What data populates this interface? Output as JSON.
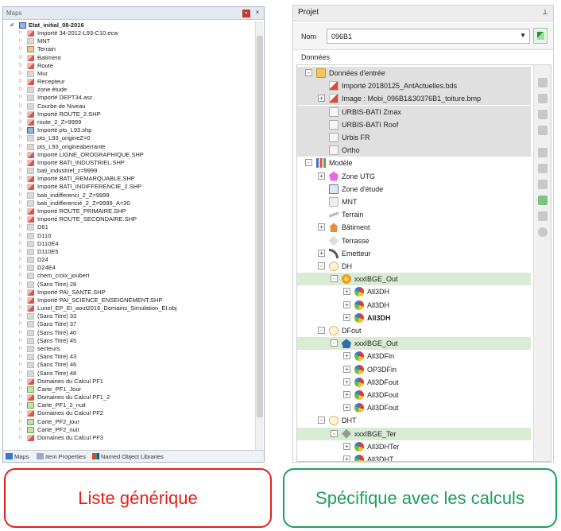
{
  "left": {
    "title": "Maps",
    "root_label": "Etat_initial_08-2016",
    "layers": [
      {
        "label": "Importé 34-2012-L93-C10.ecw",
        "icon": "red"
      },
      {
        "label": "MNT",
        "icon": "grey"
      },
      {
        "label": "Terrain",
        "icon": "tan"
      },
      {
        "label": "Batiment",
        "icon": "red"
      },
      {
        "label": "Route",
        "icon": "red"
      },
      {
        "label": "Mur",
        "icon": "grey"
      },
      {
        "label": "Recepteur",
        "icon": "red"
      },
      {
        "label": "zone étude",
        "icon": "grey"
      },
      {
        "label": "Importé DEPT34.asc",
        "icon": "grey"
      },
      {
        "label": "Courbe de Niveau",
        "icon": "grey"
      },
      {
        "label": "Importé ROUTE_2.SHP",
        "icon": "red"
      },
      {
        "label": "route_2_Z=9999",
        "icon": "red"
      },
      {
        "label": "Importé pts_L93.shp",
        "icon": "blue"
      },
      {
        "label": "pts_L93_origineZ=0",
        "icon": "grey"
      },
      {
        "label": "pts_L93_origineaberrante",
        "icon": "grey"
      },
      {
        "label": "Importé LIGNE_OROGRAPHIQUE.SHP",
        "icon": "red"
      },
      {
        "label": "Importé BATI_INDUSTRIEL.SHP",
        "icon": "red"
      },
      {
        "label": "bati_industriel_z=9999",
        "icon": "grey"
      },
      {
        "label": "Importé BATI_REMARQUABLE.SHP",
        "icon": "red"
      },
      {
        "label": "Importé BATI_INDIFFERENCIE_2.SHP",
        "icon": "red"
      },
      {
        "label": "bati_indifferenci_2_Z=9999",
        "icon": "grey"
      },
      {
        "label": "bati_indifferencié_2_Z=9999_A<30",
        "icon": "grey"
      },
      {
        "label": "Importé ROUTE_PRIMAIRE.SHP",
        "icon": "red"
      },
      {
        "label": "Importé ROUTE_SECONDAIRE.SHP",
        "icon": "red"
      },
      {
        "label": "D61",
        "icon": "grey"
      },
      {
        "label": "D110",
        "icon": "grey"
      },
      {
        "label": "D110E4",
        "icon": "grey"
      },
      {
        "label": "D110E5",
        "icon": "grey"
      },
      {
        "label": "D24",
        "icon": "grey"
      },
      {
        "label": "D24E4",
        "icon": "grey"
      },
      {
        "label": "chem_croix_joubert",
        "icon": "grey"
      },
      {
        "label": "(Sans Titre) 28",
        "icon": "grey"
      },
      {
        "label": "Importé PAI_SANTE.SHP",
        "icon": "red"
      },
      {
        "label": "Importé PAI_SCIENCE_ENSEIGNEMENT.SHP",
        "icon": "red"
      },
      {
        "label": "Lunel_EP_EI_aout2016_Domains_Simulation_EI.obj",
        "icon": "red"
      },
      {
        "label": "(Sans Titre) 33",
        "icon": "grey"
      },
      {
        "label": "(Sans Titre) 37",
        "icon": "grey"
      },
      {
        "label": "(Sans Titre) 40",
        "icon": "grey"
      },
      {
        "label": "(Sans Titre) 45",
        "icon": "grey"
      },
      {
        "label": "secteurs",
        "icon": "grey"
      },
      {
        "label": "(Sans Titre) 43",
        "icon": "grey"
      },
      {
        "label": "(Sans Titre) 46",
        "icon": "grey"
      },
      {
        "label": "(Sans Titre) 48",
        "icon": "grey"
      },
      {
        "label": "Domaines du Calcul PF1",
        "icon": "red"
      },
      {
        "label": "Carte_PF1_Jour",
        "icon": "green"
      },
      {
        "label": "Domaines du Calcul PF1_2",
        "icon": "red"
      },
      {
        "label": "Carte_PF1_2_nuit",
        "icon": "green"
      },
      {
        "label": "Domaines du Calcul PF2",
        "icon": "red"
      },
      {
        "label": "Carte_PF2_jour",
        "icon": "green"
      },
      {
        "label": "Carte_PF2_nuit",
        "icon": "green"
      },
      {
        "label": "Domaines du Calcul PF3",
        "icon": "red"
      }
    ],
    "tabs": [
      "Maps",
      "Item Properties",
      "Named Object Libraries"
    ]
  },
  "right": {
    "title": "Projet",
    "nom_label": "Nom",
    "nom_value": "096B1",
    "donnees_label": "Données",
    "items": [
      {
        "label": "Données d'entrée",
        "indent": 0,
        "expander": "-",
        "icon": "folder",
        "bg": "grey"
      },
      {
        "label": "Importé 20180125_AntActuelles.bds",
        "indent": 1,
        "expander": "",
        "icon": "redfile",
        "bg": "grey"
      },
      {
        "label": "Image : Mobi_096B1&30376B1_toiture.bmp",
        "indent": 1,
        "expander": "+",
        "icon": "redfile",
        "bg": "grey"
      },
      {
        "label": "URBIS-BATI Zmax",
        "indent": 1,
        "expander": "",
        "icon": "whitefile",
        "bg": "grey"
      },
      {
        "label": "URBIS-BATI Roof",
        "indent": 1,
        "expander": "",
        "icon": "whitefile",
        "bg": "grey"
      },
      {
        "label": "Urbis FR",
        "indent": 1,
        "expander": "",
        "icon": "whitefile",
        "bg": "grey"
      },
      {
        "label": "Ortho",
        "indent": 1,
        "expander": "",
        "icon": "whitefile",
        "bg": "grey"
      },
      {
        "label": "Modèle",
        "indent": 0,
        "expander": "-",
        "icon": "model",
        "bg": ""
      },
      {
        "label": "Zone UTG",
        "indent": 1,
        "expander": "+",
        "icon": "pink",
        "bg": ""
      },
      {
        "label": "Zone d'étude",
        "indent": 1,
        "expander": "",
        "icon": "zone",
        "bg": ""
      },
      {
        "label": "MNT",
        "indent": 1,
        "expander": "",
        "icon": "mnt",
        "bg": ""
      },
      {
        "label": "Terrain",
        "indent": 1,
        "expander": "",
        "icon": "terrain",
        "bg": ""
      },
      {
        "label": "Bâtiment",
        "indent": 1,
        "expander": "+",
        "icon": "house",
        "bg": ""
      },
      {
        "label": "Terrasse",
        "indent": 1,
        "expander": "",
        "icon": "terrasse",
        "bg": ""
      },
      {
        "label": "Emetteur",
        "indent": 1,
        "expander": "+",
        "icon": "emet",
        "bg": ""
      },
      {
        "label": "DH",
        "indent": 1,
        "expander": "-",
        "icon": "dh",
        "bg": ""
      },
      {
        "label": "xxxIBGE_Out",
        "indent": 2,
        "expander": "-",
        "icon": "ibge1",
        "bg": "green"
      },
      {
        "label": "All3DH",
        "indent": 3,
        "expander": "+",
        "icon": "res",
        "bg": ""
      },
      {
        "label": "All3DH",
        "indent": 3,
        "expander": "+",
        "icon": "res",
        "bg": ""
      },
      {
        "label": "All3DH",
        "indent": 3,
        "expander": "+",
        "icon": "res",
        "bg": "",
        "bold": true
      },
      {
        "label": "DFout",
        "indent": 1,
        "expander": "-",
        "icon": "dh",
        "bg": ""
      },
      {
        "label": "xxxIBGE_Out",
        "indent": 2,
        "expander": "-",
        "icon": "ibge2",
        "bg": "green"
      },
      {
        "label": "All3DFin",
        "indent": 3,
        "expander": "+",
        "icon": "res",
        "bg": ""
      },
      {
        "label": "OP3DFin",
        "indent": 3,
        "expander": "+",
        "icon": "res",
        "bg": ""
      },
      {
        "label": "All3DFout",
        "indent": 3,
        "expander": "+",
        "icon": "res",
        "bg": ""
      },
      {
        "label": "All3DFout",
        "indent": 3,
        "expander": "+",
        "icon": "res",
        "bg": ""
      },
      {
        "label": "All3DFout",
        "indent": 3,
        "expander": "+",
        "icon": "res",
        "bg": ""
      },
      {
        "label": "DHT",
        "indent": 1,
        "expander": "-",
        "icon": "dh",
        "bg": ""
      },
      {
        "label": "xxxIBGE_Ter",
        "indent": 2,
        "expander": "-",
        "icon": "ibge3",
        "bg": "green"
      },
      {
        "label": "All3DHTer",
        "indent": 3,
        "expander": "+",
        "icon": "res",
        "bg": ""
      },
      {
        "label": "All3DHT",
        "indent": 3,
        "expander": "+",
        "icon": "res",
        "bg": ""
      }
    ]
  },
  "captions": {
    "left": "Liste générique",
    "right": "Spécifique avec les calculs"
  }
}
